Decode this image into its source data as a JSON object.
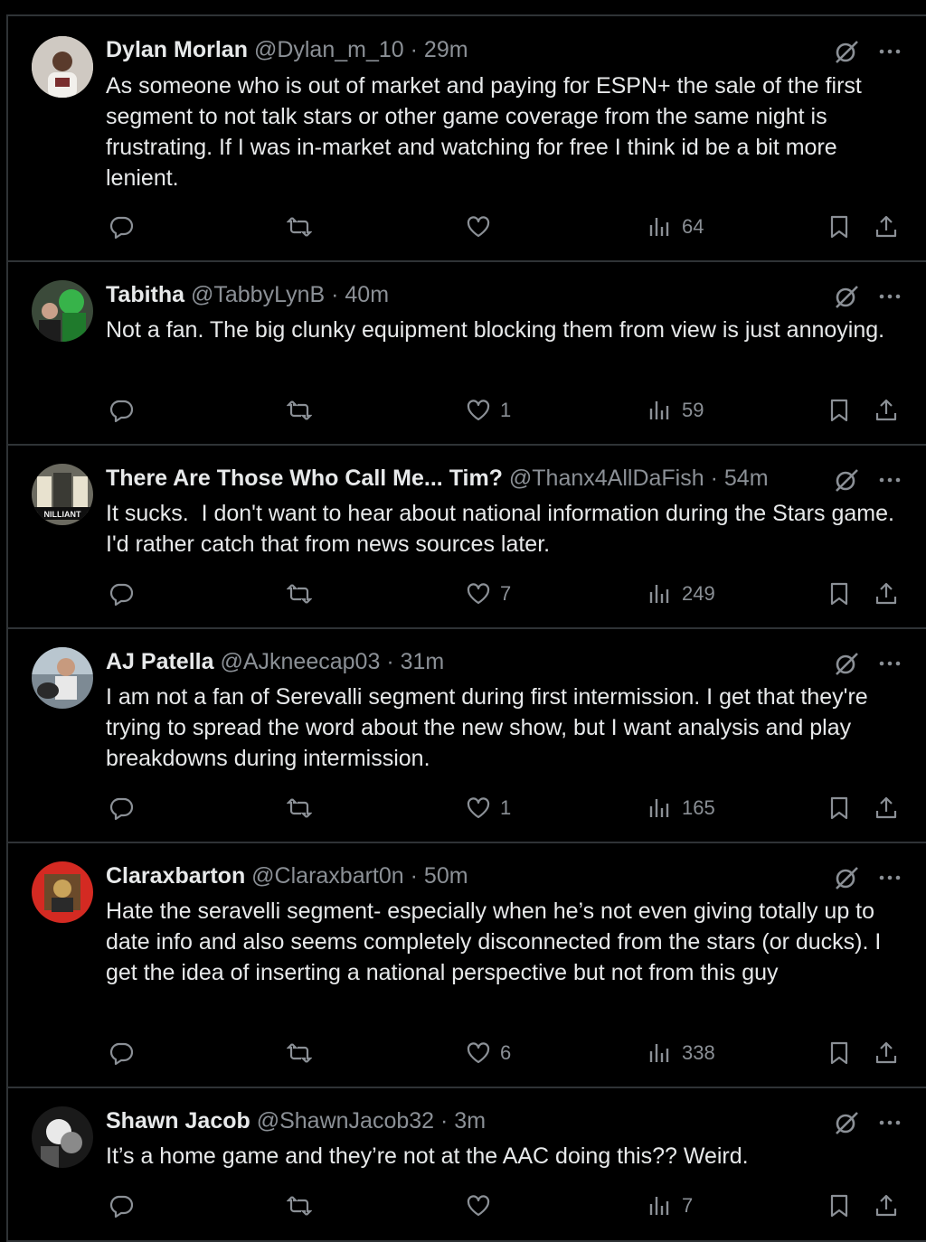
{
  "posts": [
    {
      "name": "Dylan Morlan",
      "handle": "@Dylan_m_10",
      "sep": "·",
      "time": "29m",
      "text": "As someone who is out of market and paying for ESPN+ the sale of the first segment to not talk stars or other game coverage from the same night is frustrating. If I was in-market and watching for free I think id be a bit more lenient.",
      "likes": "",
      "views": "64"
    },
    {
      "name": "Tabitha",
      "handle": "@TabbyLynB",
      "sep": "·",
      "time": "40m",
      "text": "Not a fan. The big clunky equipment blocking them from view is just annoying.",
      "likes": "1",
      "views": "59"
    },
    {
      "name": "There Are Those Who Call Me... Tim?",
      "handle": "@Thanx4AllDaFish",
      "sep": "·",
      "time": "54m",
      "text": "It sucks.  I don't want to hear about national information during the Stars game.  I'd rather catch that from news sources later.",
      "likes": "7",
      "views": "249"
    },
    {
      "name": "AJ Patella",
      "handle": "@AJkneecap03",
      "sep": "·",
      "time": "31m",
      "text": "I am not a fan of Serevalli segment during first intermission. I get that they're trying to spread the word about the new show, but I want analysis and play breakdowns during intermission.",
      "likes": "1",
      "views": "165"
    },
    {
      "name": "Claraxbarton",
      "handle": "@Claraxbart0n",
      "sep": "·",
      "time": "50m",
      "text": "Hate the seravelli segment- especially when he’s not even giving totally up to date info and also seems completely disconnected from the stars (or ducks). I get the idea of inserting a national perspective but not from this guy",
      "likes": "6",
      "views": "338"
    },
    {
      "name": "Shawn Jacob",
      "handle": "@ShawnJacob32",
      "sep": "·",
      "time": "3m",
      "text": "It’s a home game and they’re not at the AAC doing this?? Weird.",
      "likes": "",
      "views": "7"
    }
  ],
  "avatar_text": "NILLIANT",
  "icons": [
    "grok-icon",
    "more-icon",
    "reply-icon",
    "repost-icon",
    "like-icon",
    "views-icon",
    "bookmark-icon",
    "share-icon"
  ],
  "colors": {
    "background": "#000000",
    "text": "#e7e9ea",
    "muted": "#8b9096",
    "divider": "#2f3336"
  }
}
